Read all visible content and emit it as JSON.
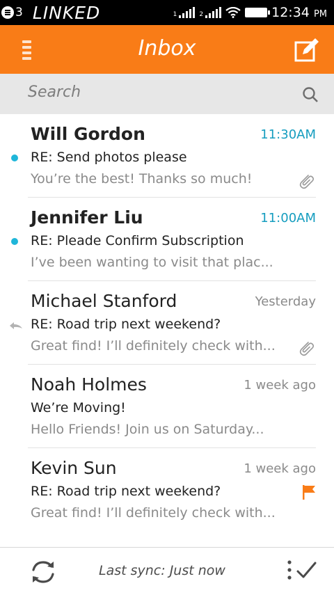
{
  "status_bar": {
    "notification_count": "3",
    "carrier": "LINKED",
    "sim1_label": "1",
    "sim2_label": "2",
    "time": "12:34",
    "ampm": "PM"
  },
  "header": {
    "title": "Inbox",
    "menu_icon": "hamburger-icon",
    "compose_icon": "compose-icon"
  },
  "search": {
    "placeholder": "Search"
  },
  "messages": [
    {
      "sender": "Will Gordon",
      "time": "11:30AM",
      "subject": "RE: Send photos please",
      "preview": "You’re the best! Thanks so much!",
      "unread": true,
      "attachment": true,
      "replied": false,
      "flagged": false
    },
    {
      "sender": "Jennifer Liu",
      "time": "11:00AM",
      "subject": "RE: Pleade Confirm Subscription",
      "preview": "I’ve been wanting to visit that plac...",
      "unread": true,
      "attachment": false,
      "replied": false,
      "flagged": false
    },
    {
      "sender": "Michael Stanford",
      "time": "Yesterday",
      "subject": "RE: Road trip next weekend?",
      "preview": "Great find! I’ll definitely check with...",
      "unread": false,
      "attachment": true,
      "replied": true,
      "flagged": false
    },
    {
      "sender": "Noah Holmes",
      "time": "1 week ago",
      "subject": "We’re Moving!",
      "preview": "Hello Friends! Join us on Saturday...",
      "unread": false,
      "attachment": false,
      "replied": false,
      "flagged": false
    },
    {
      "sender": "Kevin Sun",
      "time": "1 week ago",
      "subject": "RE: Road trip next weekend?",
      "preview": "Great find! I’ll definitely check with...",
      "unread": false,
      "attachment": false,
      "replied": false,
      "flagged": true
    }
  ],
  "footer": {
    "sync_text": "Last sync: Just now"
  },
  "colors": {
    "accent": "#f97c17",
    "unread_time": "#159dbf",
    "unread_dot": "#1fb6d9",
    "flag": "#f97c17"
  }
}
